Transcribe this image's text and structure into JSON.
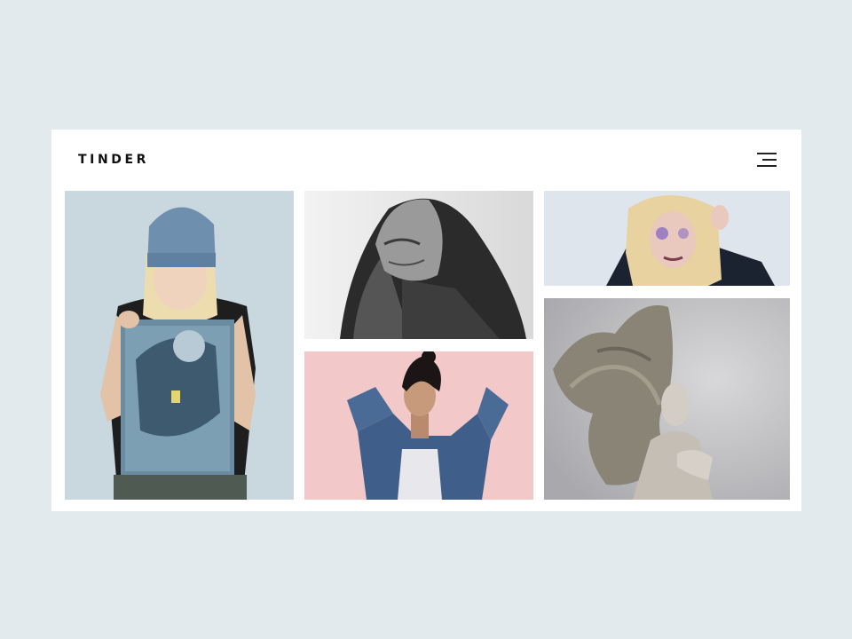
{
  "header": {
    "brand": "TINDER",
    "menu_icon": "hamburger-menu-icon"
  },
  "gallery": {
    "photos": [
      {
        "id": "photo-1",
        "subject": "woman-in-beanie-holding-print",
        "tone": "#c9d7de"
      },
      {
        "id": "photo-2",
        "subject": "bw-portrait-windswept-hair",
        "tone": "#e6e6e6"
      },
      {
        "id": "photo-3",
        "subject": "blonde-woman-face-paint",
        "tone": "#dfe5ec"
      },
      {
        "id": "photo-4",
        "subject": "woman-denim-jacket-pink-wall",
        "tone": "#f2c9c8"
      },
      {
        "id": "photo-5",
        "subject": "woman-flying-hair-grey-backdrop",
        "tone": "#c6c6c8"
      }
    ]
  },
  "colors": {
    "page_background": "#e2eaed",
    "card_background": "#ffffff",
    "text": "#111111"
  }
}
